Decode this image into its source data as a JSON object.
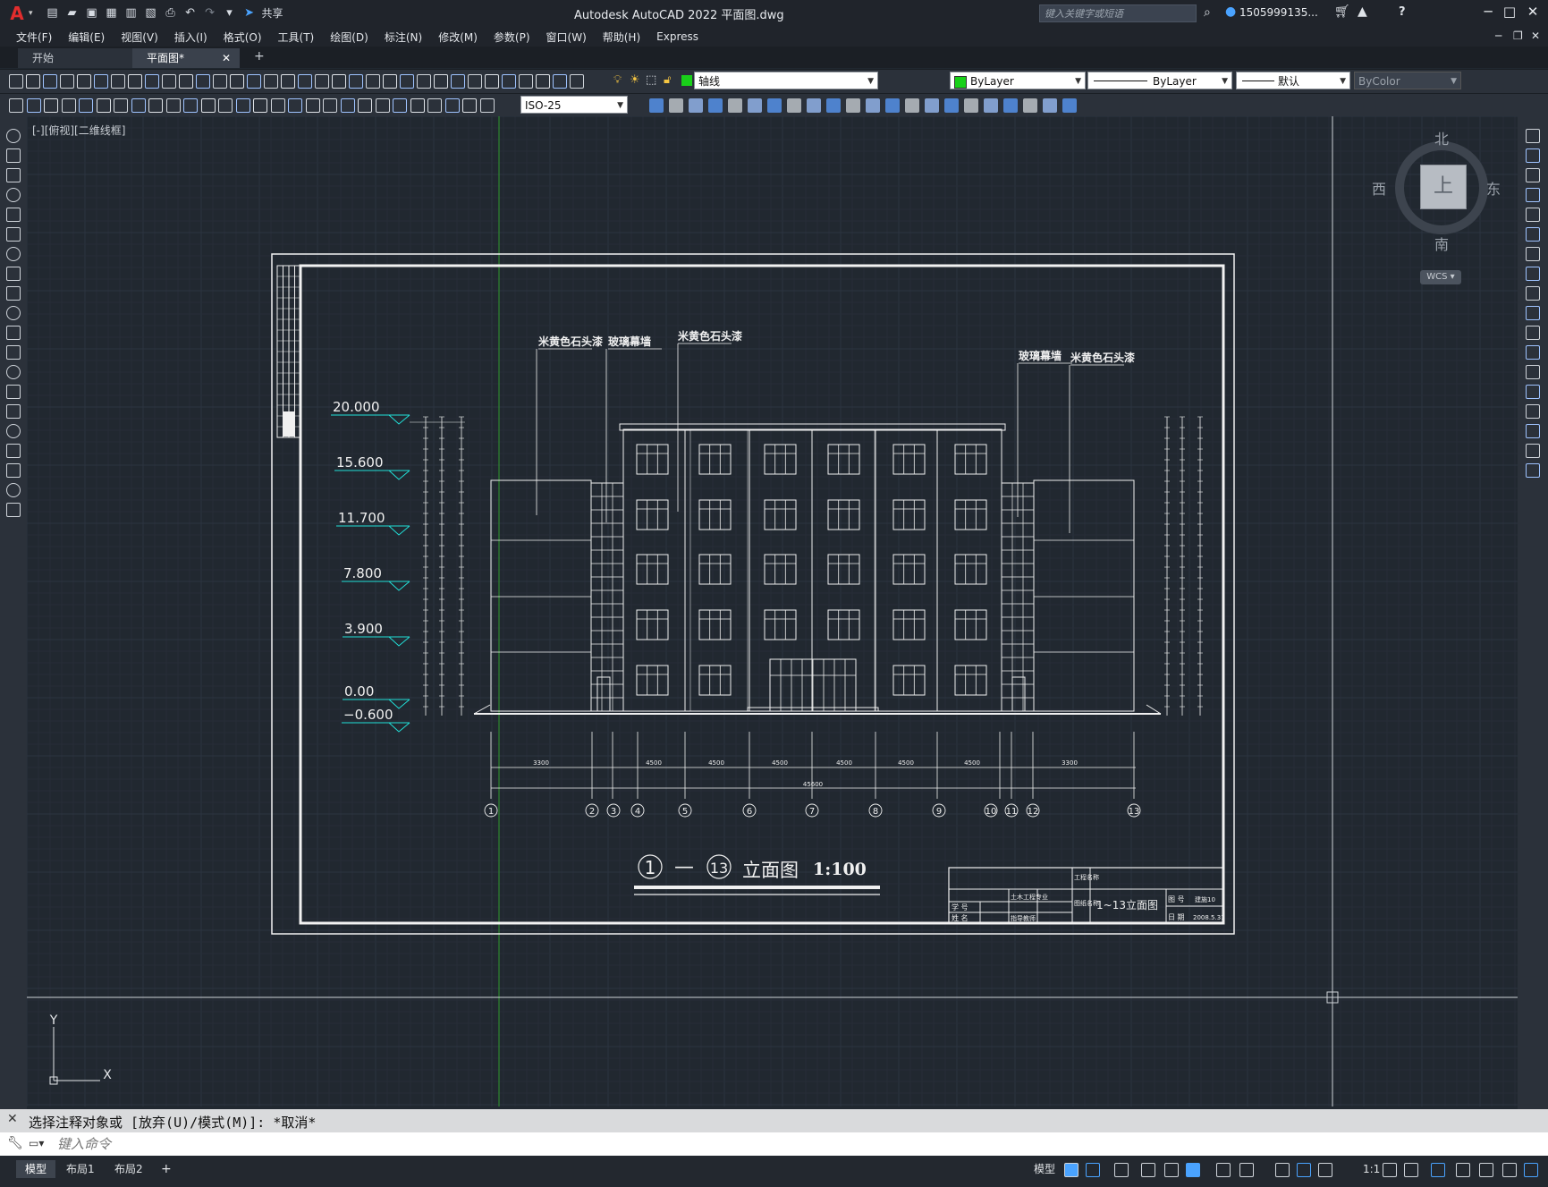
{
  "app": {
    "title": "Autodesk AutoCAD 2022    平面图.dwg",
    "logo": "A",
    "share_label": "共享",
    "search_placeholder": "键入关键字或短语",
    "user": "1505999135...",
    "help": "?"
  },
  "menu": [
    "文件(F)",
    "编辑(E)",
    "视图(V)",
    "插入(I)",
    "格式(O)",
    "工具(T)",
    "绘图(D)",
    "标注(N)",
    "修改(M)",
    "参数(P)",
    "窗口(W)",
    "帮助(H)",
    "Express"
  ],
  "tabs": {
    "start": "开始",
    "active": "平面图*",
    "close": "✕",
    "add": "+"
  },
  "toolbar": {
    "layer": "轴线",
    "color": "ByLayer",
    "linetype": "ByLayer",
    "lineweight": "默认",
    "plotstyle": "ByColor",
    "dimstyle": "ISO-25"
  },
  "viewport_label": "[-][俯视][二维线框]",
  "viewcube": {
    "north": "北",
    "south": "南",
    "east": "东",
    "west": "西",
    "top": "上",
    "wcs": "WCS"
  },
  "drawing": {
    "elevations": [
      "20.000",
      "15.600",
      "11.700",
      "7.800",
      "3.900",
      "0.00",
      "−0.600"
    ],
    "callouts": [
      "米黄色石头漆",
      "玻璃幕墙",
      "米黄色石头漆",
      "玻璃幕墙",
      "米黄色石头漆"
    ],
    "axis_labels": [
      "1",
      "2",
      "3",
      "4",
      "5",
      "6",
      "7",
      "8",
      "9",
      "10",
      "11",
      "12",
      "13"
    ],
    "dim_labels": [
      "3300",
      "4500",
      "4500",
      "4500",
      "4500",
      "4500",
      "4500",
      "3300"
    ],
    "dim_total": "45600",
    "title_circle_left": "1",
    "title_dash": "—",
    "title_circle_right": "13",
    "title_text": "立面图",
    "title_scale": "1:100",
    "titleblock": {
      "project": "工程名称",
      "drawing_name": "1~13立面图",
      "figname_label": "图纸名称",
      "fig_no_label": "图 号",
      "fig_no": "建施10",
      "date_label": "日 期",
      "date": "2008.5.31",
      "school": "土木工程专业",
      "student_label": "学 号",
      "name_label": "姓 名",
      "advisor": "指导教师"
    }
  },
  "cmd": {
    "history": "选择注释对象或 [放弃(U)/模式(M)]: *取消*",
    "placeholder": "键入命令"
  },
  "status": {
    "layout_tabs": [
      "模型",
      "布局1",
      "布局2"
    ],
    "add": "+",
    "model_label": "模型",
    "scale": "1:1"
  }
}
